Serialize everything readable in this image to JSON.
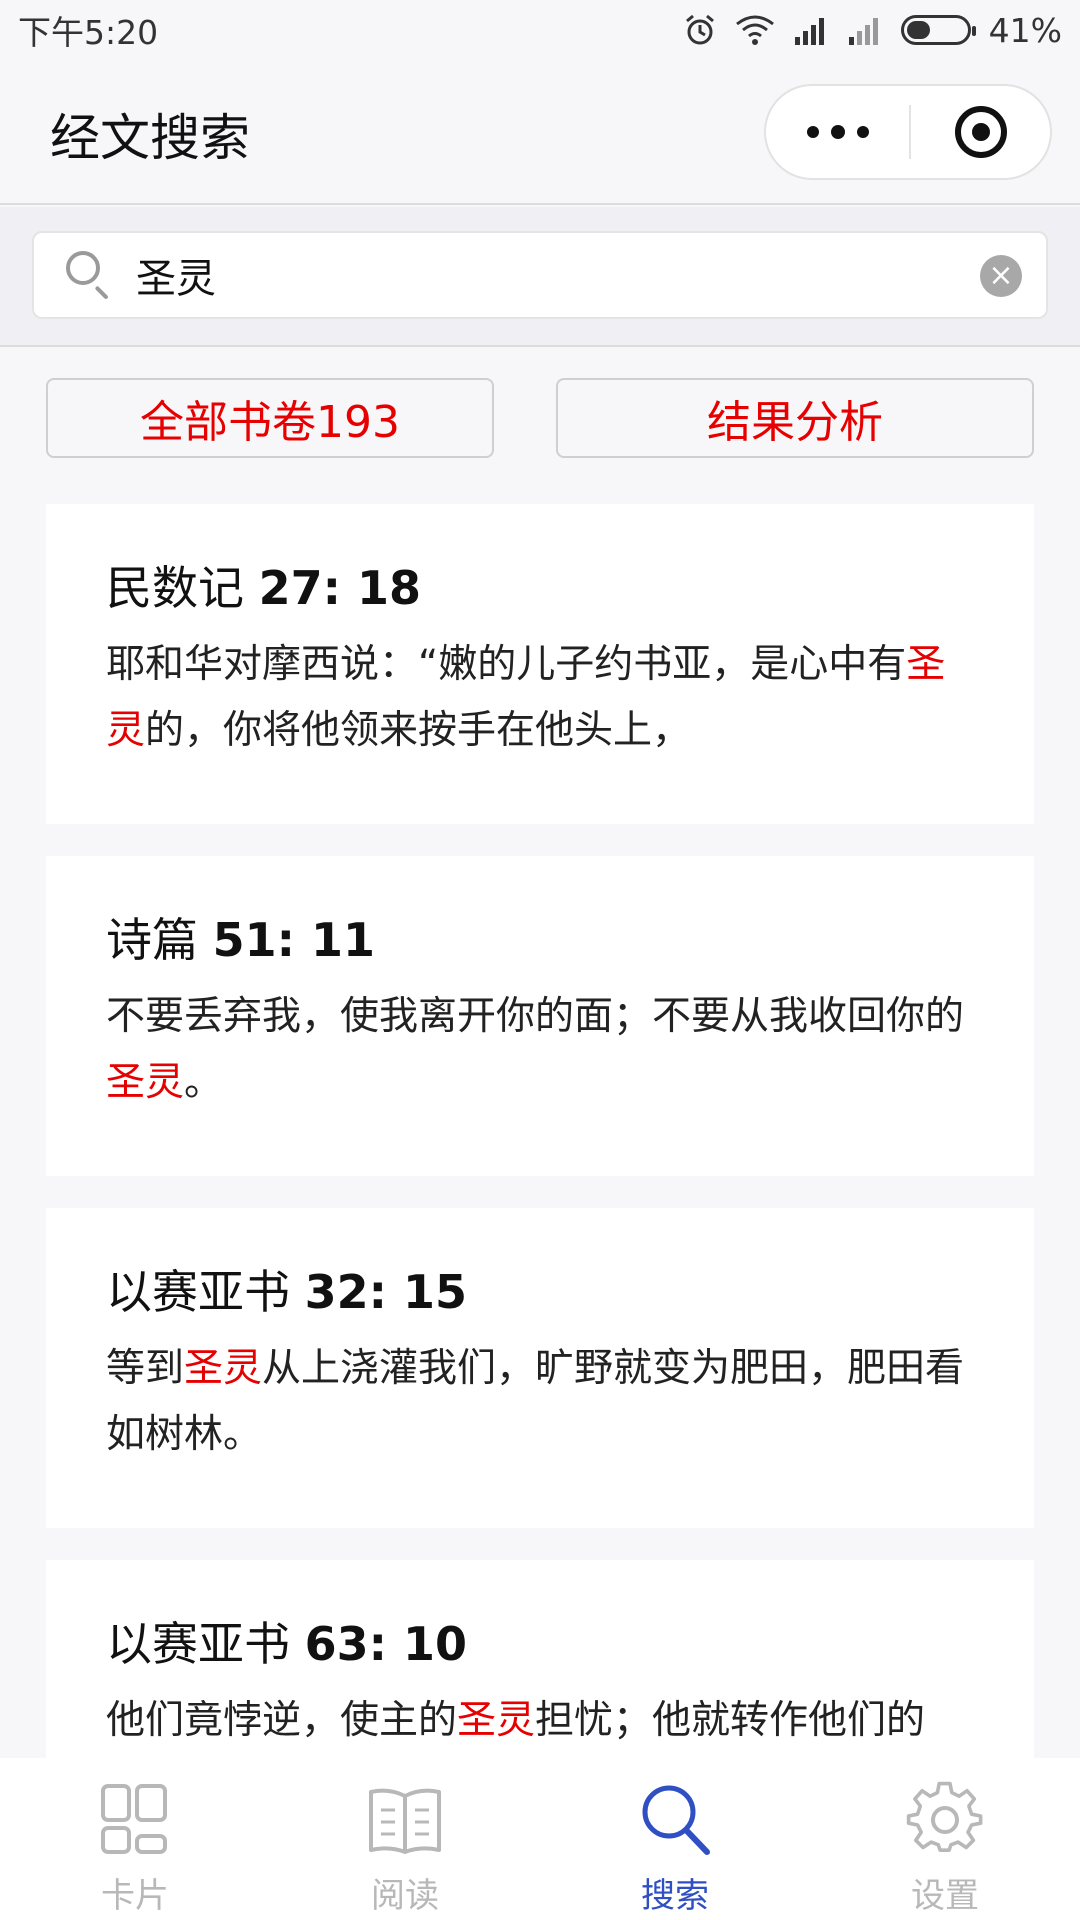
{
  "status_bar": {
    "time": "下午5:20",
    "battery": "41%",
    "battery_level": 0.41
  },
  "nav": {
    "title": "经文搜索"
  },
  "search": {
    "value": "圣灵",
    "clear_label": "×"
  },
  "filters": {
    "books_label": "全部书卷193",
    "analysis_label": "结果分析"
  },
  "results": [
    {
      "book": "民数记",
      "ref": "27: 18",
      "text_before": "耶和华对摩西说：“嫩的儿子约书亚，是心中有",
      "highlight": "圣灵",
      "text_after": "的，你将他领来按手在他头上，"
    },
    {
      "book": "诗篇",
      "ref": "51: 11",
      "text_before": "不要丢弃我，使我离开你的面；不要从我收回你的",
      "highlight": "圣灵",
      "text_after": "。"
    },
    {
      "book": "以赛亚书",
      "ref": "32: 15",
      "text_before": "等到",
      "highlight": "圣灵",
      "text_after": "从上浇灌我们，旷野就变为肥田，肥田看如树林。"
    },
    {
      "book": "以赛亚书",
      "ref": "63: 10",
      "text_before": "他们竟悖逆，使主的",
      "highlight": "圣灵",
      "text_after": "担忧；他就转作他们的"
    }
  ],
  "tabs": [
    {
      "label": "卡片",
      "icon": "cards-icon",
      "active": false
    },
    {
      "label": "阅读",
      "icon": "book-icon",
      "active": false
    },
    {
      "label": "搜索",
      "icon": "search-icon",
      "active": true
    },
    {
      "label": "设置",
      "icon": "gear-icon",
      "active": false
    }
  ],
  "colors": {
    "highlight": "#e60000",
    "active_tab": "#2f4fc3",
    "inactive_tab": "#b8b8b8"
  }
}
